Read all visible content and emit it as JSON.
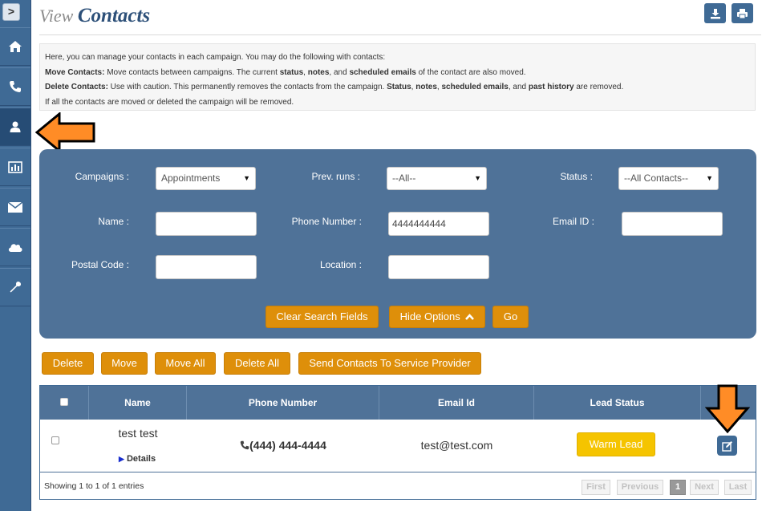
{
  "sidebar": {
    "toggle": ">",
    "items": [
      {
        "name": "home-icon"
      },
      {
        "name": "phone-icon"
      },
      {
        "name": "user-icon"
      },
      {
        "name": "chart-icon"
      },
      {
        "name": "envelope-icon"
      },
      {
        "name": "cloud-icon"
      },
      {
        "name": "wrench-icon"
      }
    ],
    "active_index": 2
  },
  "header": {
    "title_prefix": "View",
    "title": "Contacts",
    "download_icon": "download-icon",
    "print_icon": "print-icon"
  },
  "info": {
    "line1": "Here, you can manage your contacts in each campaign. You may do the following with contacts:",
    "move_label": "Move Contacts:",
    "move_text_a": " Move contacts between campaigns. The current ",
    "move_b1": "status",
    "move_sep1": ", ",
    "move_b2": "notes",
    "move_sep2": ", and ",
    "move_b3": "scheduled emails",
    "move_text_b": " of the contact are also moved.",
    "delete_label": "Delete Contacts:",
    "delete_text_a": " Use with caution. This permanently removes the contacts from the campaign. ",
    "delete_b1": "Status",
    "delete_sep1": ", ",
    "delete_b2": "notes",
    "delete_sep2": ", ",
    "delete_b3": "scheduled emails",
    "delete_sep3": ", and ",
    "delete_b4": "past history",
    "delete_text_b": " are removed.",
    "line4": "If all the contacts are moved or deleted the campaign will be removed."
  },
  "search": {
    "campaigns_label": "Campaigns :",
    "campaigns_value": "Appointments",
    "prev_runs_label": "Prev. runs :",
    "prev_runs_value": "--All--",
    "status_label": "Status :",
    "status_value": "--All Contacts--",
    "name_label": "Name :",
    "name_value": "",
    "phone_label": "Phone Number :",
    "phone_value": "4444444444",
    "email_label": "Email ID :",
    "email_value": "",
    "postal_label": "Postal Code :",
    "postal_value": "",
    "location_label": "Location :",
    "location_value": "",
    "clear_button": "Clear Search Fields",
    "hide_button": "Hide Options",
    "go_button": "Go"
  },
  "actions": {
    "delete": "Delete",
    "move": "Move",
    "move_all": "Move All",
    "delete_all": "Delete All",
    "send": "Send Contacts To Service Provider"
  },
  "table": {
    "columns": [
      "Name",
      "Phone Number",
      "Email Id",
      "Lead Status"
    ],
    "rows": [
      {
        "name": "test test",
        "details": "Details",
        "phone": "(444) 444-4444",
        "email": "test@test.com",
        "lead_status": "Warm Lead"
      }
    ],
    "footer": "Showing 1 to 1 of 1 entries",
    "pagination": {
      "first": "First",
      "previous": "Previous",
      "page": "1",
      "next": "Next",
      "last": "Last"
    }
  },
  "colors": {
    "primary": "#4f7298",
    "sidebar": "#3f6a95",
    "accent_orange": "#de8f0a",
    "lead_yellow": "#f5c400",
    "arrow_orange": "#ff8c26"
  }
}
